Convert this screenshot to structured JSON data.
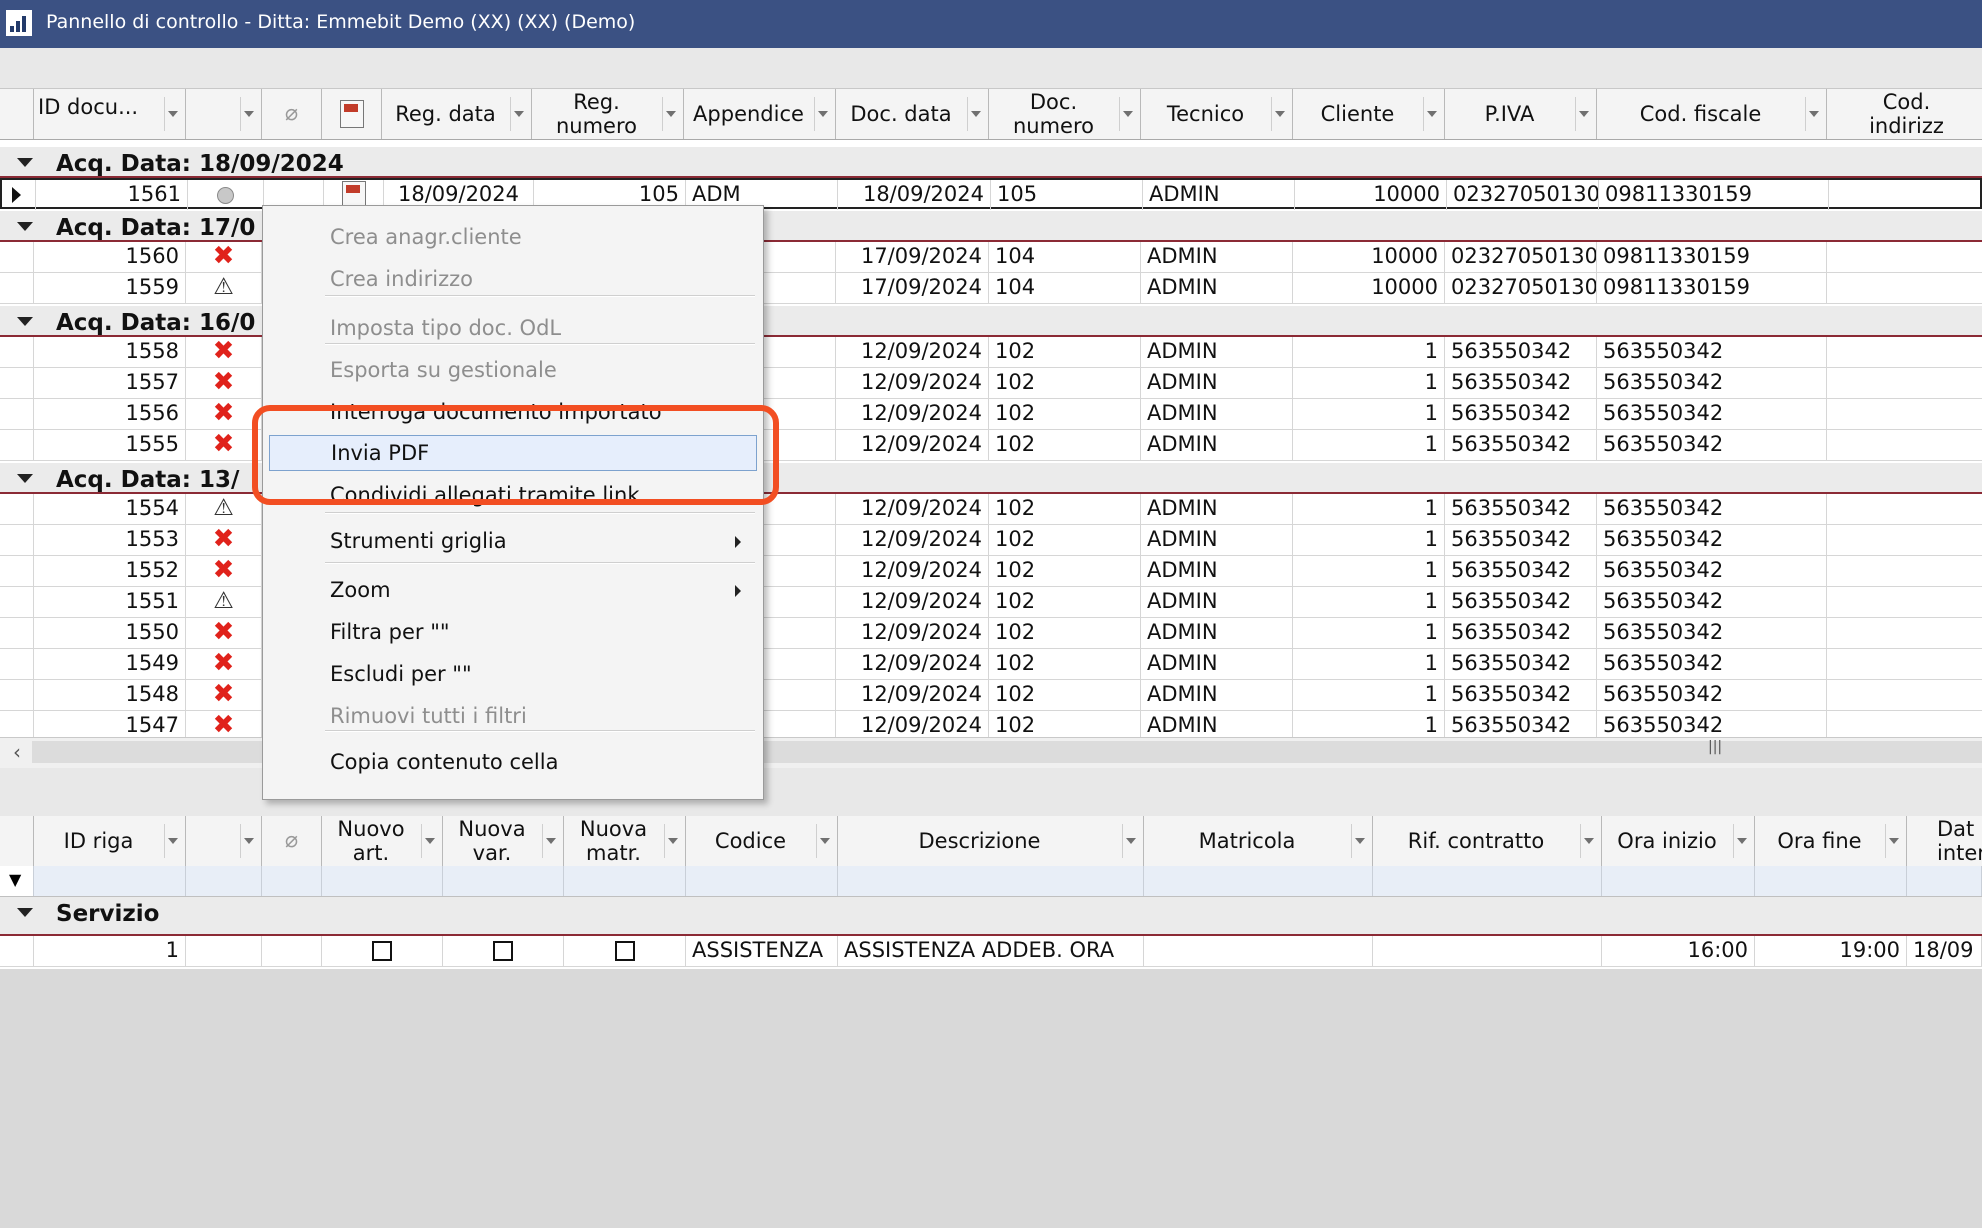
{
  "window": {
    "title": "Pannello di controllo - Ditta: Emmebit Demo (XX) (XX)  (Demo)"
  },
  "colors": {
    "titlebar": "#3b5183",
    "error_icon": "#e0221b",
    "group_border": "#8b2a35",
    "highlight_callout": "#f24e22"
  },
  "top_grid": {
    "headers": {
      "id_doc": "ID docu...",
      "reg_data": "Reg. data",
      "reg_numero": "Reg.\nnumero",
      "appendice": "Appendice",
      "doc_data": "Doc. data",
      "doc_numero": "Doc.\nnumero",
      "tecnico": "Tecnico",
      "cliente": "Cliente",
      "piva": "P.IVA",
      "cod_fiscale": "Cod. fiscale",
      "cod_indirizzo": "Cod. indirizz"
    },
    "groups": [
      "Acq. Data:  18/09/2024",
      "Acq. Data:  17/0",
      "Acq. Data:  16/0",
      "Acq. Data:  13/"
    ],
    "rows": [
      {
        "id": "1561",
        "status": "dot-icon",
        "reg_data": "18/09/2024",
        "reg_numero": "105",
        "appendice": "ADM",
        "doc_data": "18/09/2024",
        "doc_numero": "105",
        "tecnico": "ADMIN",
        "cliente": "10000",
        "piva": "02327050130",
        "cod_fiscale": "09811330159"
      },
      {
        "id": "1560",
        "status": "x-icon",
        "doc_data": "17/09/2024",
        "doc_numero": "104",
        "tecnico": "ADMIN",
        "cliente": "10000",
        "piva": "02327050130",
        "cod_fiscale": "09811330159"
      },
      {
        "id": "1559",
        "status": "warning-icon",
        "doc_data": "17/09/2024",
        "doc_numero": "104",
        "tecnico": "ADMIN",
        "cliente": "10000",
        "piva": "02327050130",
        "cod_fiscale": "09811330159"
      },
      {
        "id": "1558",
        "status": "x-icon",
        "doc_data": "12/09/2024",
        "doc_numero": "102",
        "tecnico": "ADMIN",
        "cliente": "1",
        "piva": "563550342",
        "cod_fiscale": "563550342"
      },
      {
        "id": "1557",
        "status": "x-icon",
        "doc_data": "12/09/2024",
        "doc_numero": "102",
        "tecnico": "ADMIN",
        "cliente": "1",
        "piva": "563550342",
        "cod_fiscale": "563550342"
      },
      {
        "id": "1556",
        "status": "x-icon",
        "doc_data": "12/09/2024",
        "doc_numero": "102",
        "tecnico": "ADMIN",
        "cliente": "1",
        "piva": "563550342",
        "cod_fiscale": "563550342"
      },
      {
        "id": "1555",
        "status": "x-icon",
        "doc_data": "12/09/2024",
        "doc_numero": "102",
        "tecnico": "ADMIN",
        "cliente": "1",
        "piva": "563550342",
        "cod_fiscale": "563550342"
      },
      {
        "id": "1554",
        "status": "warning-icon",
        "doc_data": "12/09/2024",
        "doc_numero": "102",
        "tecnico": "ADMIN",
        "cliente": "1",
        "piva": "563550342",
        "cod_fiscale": "563550342"
      },
      {
        "id": "1553",
        "status": "x-icon",
        "doc_data": "12/09/2024",
        "doc_numero": "102",
        "tecnico": "ADMIN",
        "cliente": "1",
        "piva": "563550342",
        "cod_fiscale": "563550342"
      },
      {
        "id": "1552",
        "status": "x-icon",
        "doc_data": "12/09/2024",
        "doc_numero": "102",
        "tecnico": "ADMIN",
        "cliente": "1",
        "piva": "563550342",
        "cod_fiscale": "563550342"
      },
      {
        "id": "1551",
        "status": "warning-icon",
        "doc_data": "12/09/2024",
        "doc_numero": "102",
        "tecnico": "ADMIN",
        "cliente": "1",
        "piva": "563550342",
        "cod_fiscale": "563550342"
      },
      {
        "id": "1550",
        "status": "x-icon",
        "doc_data": "12/09/2024",
        "doc_numero": "102",
        "tecnico": "ADMIN",
        "cliente": "1",
        "piva": "563550342",
        "cod_fiscale": "563550342"
      },
      {
        "id": "1549",
        "status": "x-icon",
        "doc_data": "12/09/2024",
        "doc_numero": "102",
        "tecnico": "ADMIN",
        "cliente": "1",
        "piva": "563550342",
        "cod_fiscale": "563550342"
      },
      {
        "id": "1548",
        "status": "x-icon",
        "doc_data": "12/09/2024",
        "doc_numero": "102",
        "tecnico": "ADMIN",
        "cliente": "1",
        "piva": "563550342",
        "cod_fiscale": "563550342"
      },
      {
        "id": "1547",
        "status": "x-icon",
        "doc_data": "12/09/2024",
        "doc_numero": "102",
        "tecnico": "ADMIN",
        "cliente": "1",
        "piva": "563550342",
        "cod_fiscale": "563550342"
      }
    ]
  },
  "context_menu": {
    "items": [
      {
        "label": "Crea anagr.cliente",
        "disabled": true
      },
      {
        "label": "Crea indirizzo",
        "disabled": true
      },
      {
        "label": "Imposta tipo doc. OdL",
        "disabled": true
      },
      {
        "label": "Esporta su gestionale",
        "disabled": true
      },
      {
        "label": "Interroga documento importato",
        "disabled": false
      },
      {
        "label": "Invia PDF",
        "disabled": false,
        "highlighted": true
      },
      {
        "label": "Condividi allegati tramite link",
        "disabled": false
      },
      {
        "label": "Strumenti griglia",
        "disabled": false,
        "submenu": true
      },
      {
        "label": "Zoom",
        "disabled": false,
        "submenu": true
      },
      {
        "label": "Filtra per \"\"",
        "disabled": false
      },
      {
        "label": "Escludi per \"\"",
        "disabled": false
      },
      {
        "label": "Rimuovi tutti i filtri",
        "disabled": true
      },
      {
        "label": "Copia contenuto cella",
        "disabled": false
      }
    ]
  },
  "bottom_grid": {
    "headers": {
      "id_riga": "ID riga",
      "nuovo_art": "Nuovo\nart.",
      "nuova_var": "Nuova\nvar.",
      "nuova_matr": "Nuova\nmatr.",
      "codice": "Codice",
      "descrizione": "Descrizione",
      "matricola": "Matricola",
      "rif_contratto": "Rif. contratto",
      "ora_inizio": "Ora inizio",
      "ora_fine": "Ora fine",
      "data_intervento": "Dat\ninterve"
    },
    "group": "Servizio",
    "rows": [
      {
        "id": "1",
        "codice": "ASSISTENZA",
        "descrizione": "ASSISTENZA ADDEB. ORA",
        "ora_inizio": "16:00",
        "ora_fine": "19:00",
        "data_intervento": "18/09"
      }
    ]
  }
}
